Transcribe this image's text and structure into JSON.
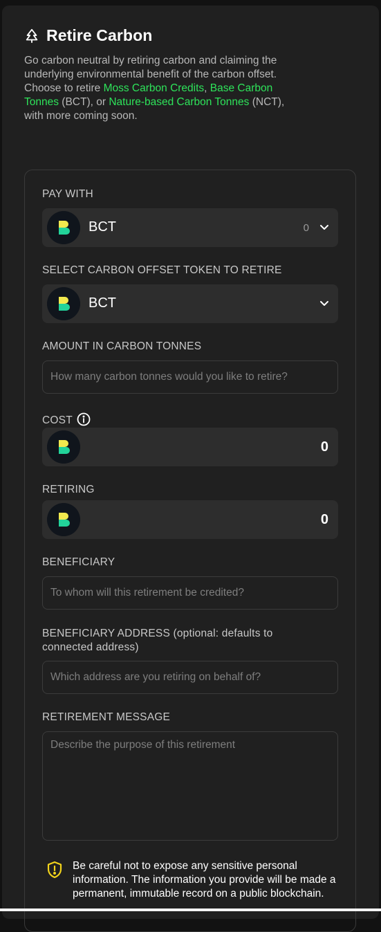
{
  "header": {
    "title": "Retire Carbon",
    "icon": "tree-icon"
  },
  "description": {
    "part1": "Go carbon neutral by retiring carbon and claiming the underlying environmental benefit of the carbon offset. Choose to retire ",
    "link1": "Moss Carbon Credits",
    "part2": ", ",
    "link2": "Base Carbon Tonnes",
    "part3": " (BCT), or ",
    "link3": "Nature-based Carbon Tonnes",
    "part4": " (NCT), with more coming soon."
  },
  "pay_with": {
    "label": "PAY WITH",
    "token": "BCT",
    "balance": "0"
  },
  "offset_token": {
    "label": "SELECT CARBON OFFSET TOKEN TO RETIRE",
    "token": "BCT"
  },
  "amount": {
    "label": "AMOUNT IN CARBON TONNES",
    "placeholder": "How many carbon tonnes would you like to retire?"
  },
  "cost": {
    "label": "COST",
    "value": "0"
  },
  "retiring": {
    "label": "RETIRING",
    "value": "0"
  },
  "beneficiary": {
    "label": "BENEFICIARY",
    "placeholder": "To whom will this retirement be credited?"
  },
  "beneficiary_address": {
    "label_line1": "BENEFICIARY ADDRESS (optional: defaults to",
    "label_line2": "connected address)",
    "placeholder": "Which address are you retiring on behalf of?"
  },
  "message": {
    "label": "RETIREMENT MESSAGE",
    "placeholder": "Describe the purpose of this retirement"
  },
  "warning": {
    "text": "Be careful not to expose any sensitive personal information. The information you provide will be made a permanent, immutable record on a public blockchain."
  },
  "colors": {
    "background": "#202020",
    "accent_green": "#2ee35a",
    "warning_yellow": "#f2d31b"
  }
}
